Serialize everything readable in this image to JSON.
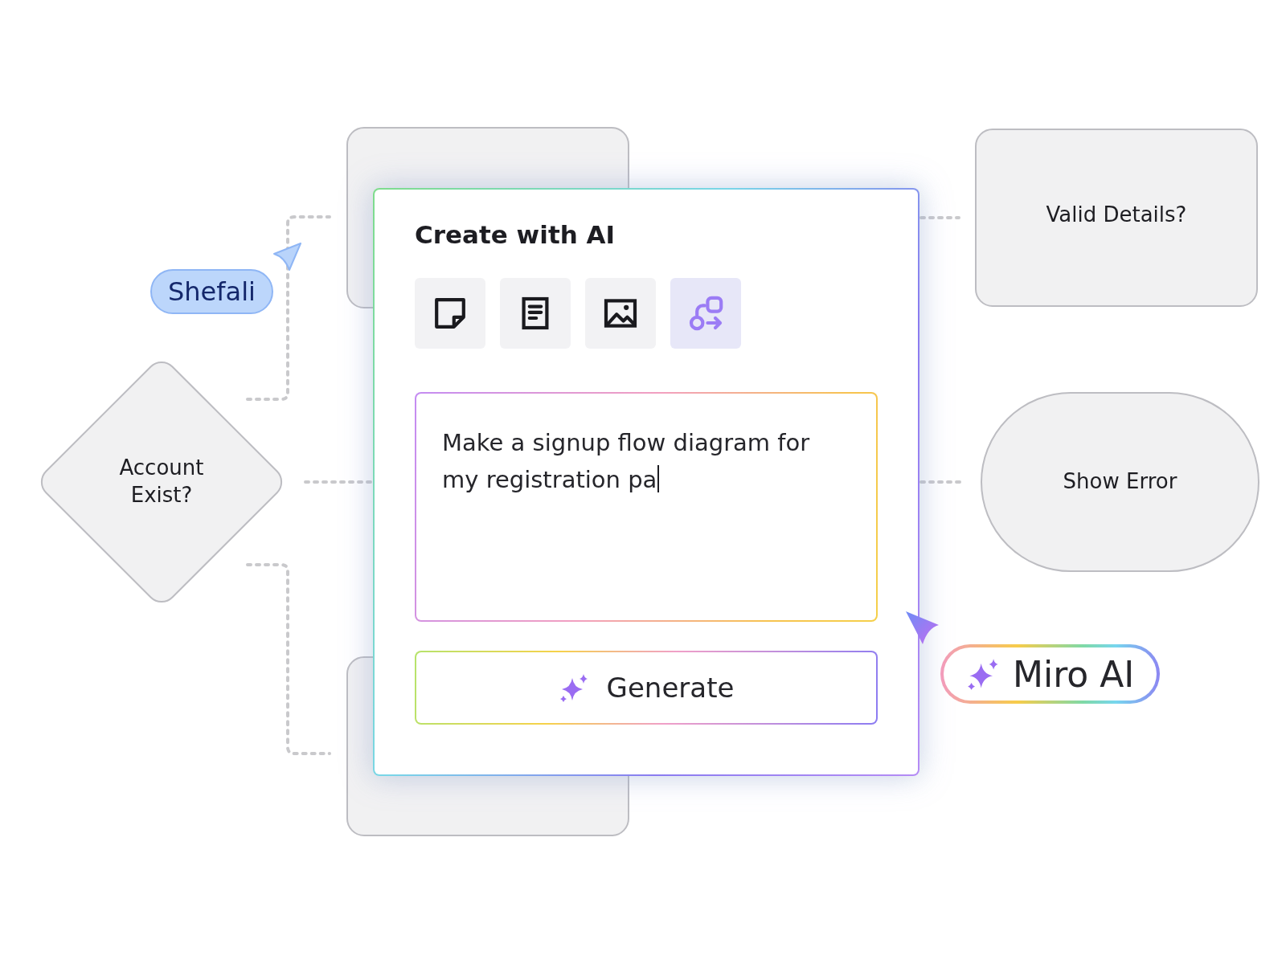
{
  "canvas": {
    "nodes": [
      {
        "kind": "diamond",
        "label": "Account\nExist?"
      },
      {
        "kind": "rect",
        "label": "Valid Details?"
      },
      {
        "kind": "stadium",
        "label": "Show Error"
      }
    ],
    "cursors": [
      {
        "kind": "person",
        "name": "Shefali"
      },
      {
        "kind": "ai",
        "name": "Miro AI"
      }
    ]
  },
  "dialog": {
    "title": "Create with AI",
    "tools": [
      {
        "kind": "sticky",
        "selected": false
      },
      {
        "kind": "text",
        "selected": false
      },
      {
        "kind": "image",
        "selected": false
      },
      {
        "kind": "diagram",
        "selected": true
      }
    ],
    "prompt": {
      "value": "Make a signup flow diagram for my registration pa"
    },
    "generate_button": "Generate"
  }
}
